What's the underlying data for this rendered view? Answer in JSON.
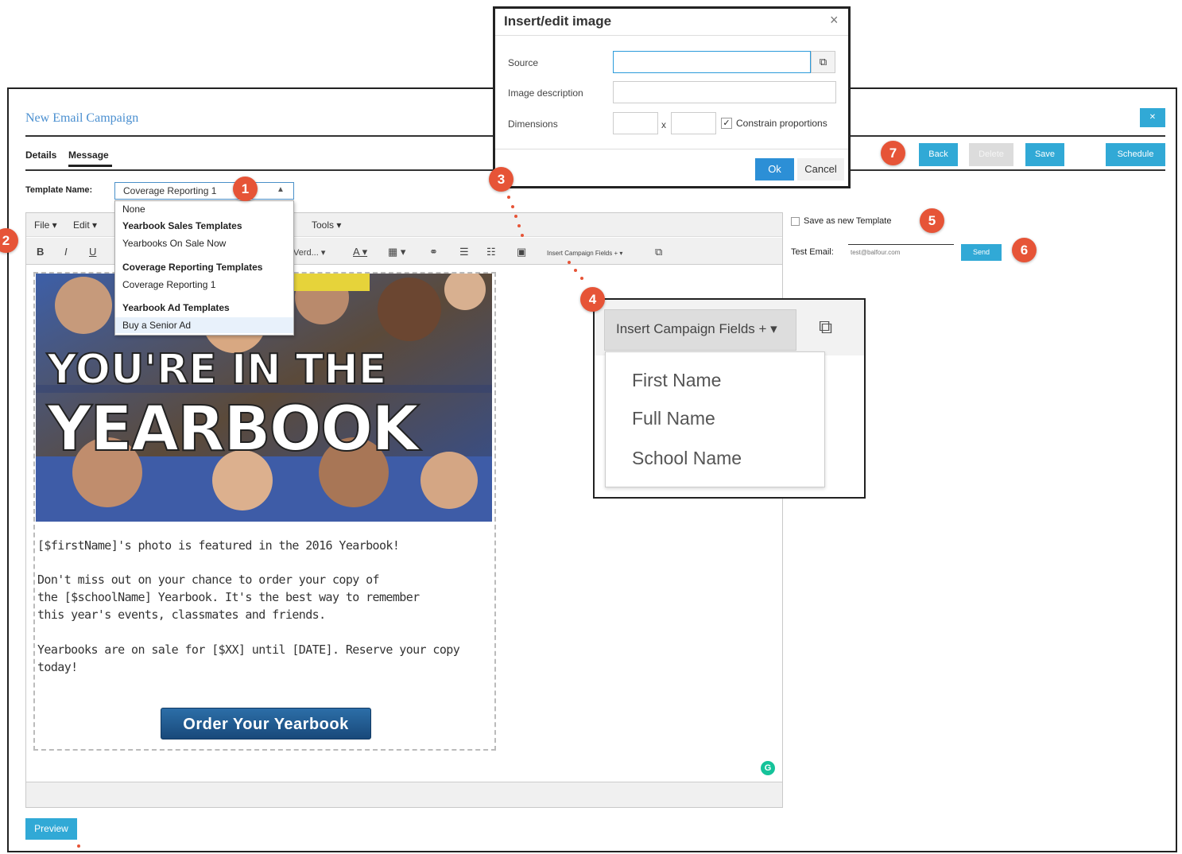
{
  "app": {
    "title": "New Email Campaign",
    "close_glyph": "✕"
  },
  "tabs": [
    {
      "label": "Details"
    },
    {
      "label": "Message"
    }
  ],
  "actions": {
    "back": "Back",
    "delete": "Delete",
    "save": "Save",
    "schedule": "Schedule"
  },
  "template": {
    "label": "Template Name:",
    "selected": "Coverage Reporting 1",
    "options": [
      {
        "label": "None",
        "type": "option"
      },
      {
        "label": "Yearbook Sales Templates",
        "type": "group"
      },
      {
        "label": "Yearbooks On Sale Now",
        "type": "option"
      },
      {
        "label": "Coverage Reporting Templates",
        "type": "group"
      },
      {
        "label": "Coverage Reporting 1",
        "type": "option"
      },
      {
        "label": "Yearbook Ad Templates",
        "type": "group"
      },
      {
        "label": "Buy a Senior Ad",
        "type": "option"
      }
    ]
  },
  "editor": {
    "menus": [
      "File",
      "Edit",
      "Tools"
    ],
    "toolbar": {
      "bold": "B",
      "italic": "I",
      "underline": "U",
      "font_size": "Verd...",
      "insert_fields": "Insert Campaign Fields"
    },
    "hero": {
      "line1": "YOU'RE IN THE",
      "line2": "YEARBOOK"
    },
    "body": [
      "[$firstName]'s photo is featured in the 2016 Yearbook!",
      "Don't miss out on your chance to order your copy of",
      "the [$schoolName] Yearbook. It's the best way to remember",
      "this year's events, classmates and friends.",
      "Yearbooks are on sale for [$XX] until [DATE]. Reserve your copy",
      "today!"
    ],
    "cta": "Order Your Yearbook"
  },
  "preview_label": "Preview",
  "side": {
    "save_as_template": "Save as new Template",
    "test_email_label": "Test Email:",
    "test_email_value": "test@balfour.com",
    "send": "Send"
  },
  "image_dialog": {
    "title": "Insert/edit image",
    "source_label": "Source",
    "description_label": "Image description",
    "dimensions_label": "Dimensions",
    "x": "x",
    "constrain_label": "Constrain proportions",
    "ok": "Ok",
    "cancel": "Cancel"
  },
  "campaign_fields": {
    "button": "Insert Campaign Fields +",
    "items": [
      "First Name",
      "Full Name",
      "School Name"
    ]
  },
  "markers": [
    "1",
    "2",
    "3",
    "4",
    "5",
    "6",
    "7"
  ],
  "colors": {
    "accent": "#31a9d6",
    "marker": "#e65437",
    "cta": "#1f5a93"
  }
}
